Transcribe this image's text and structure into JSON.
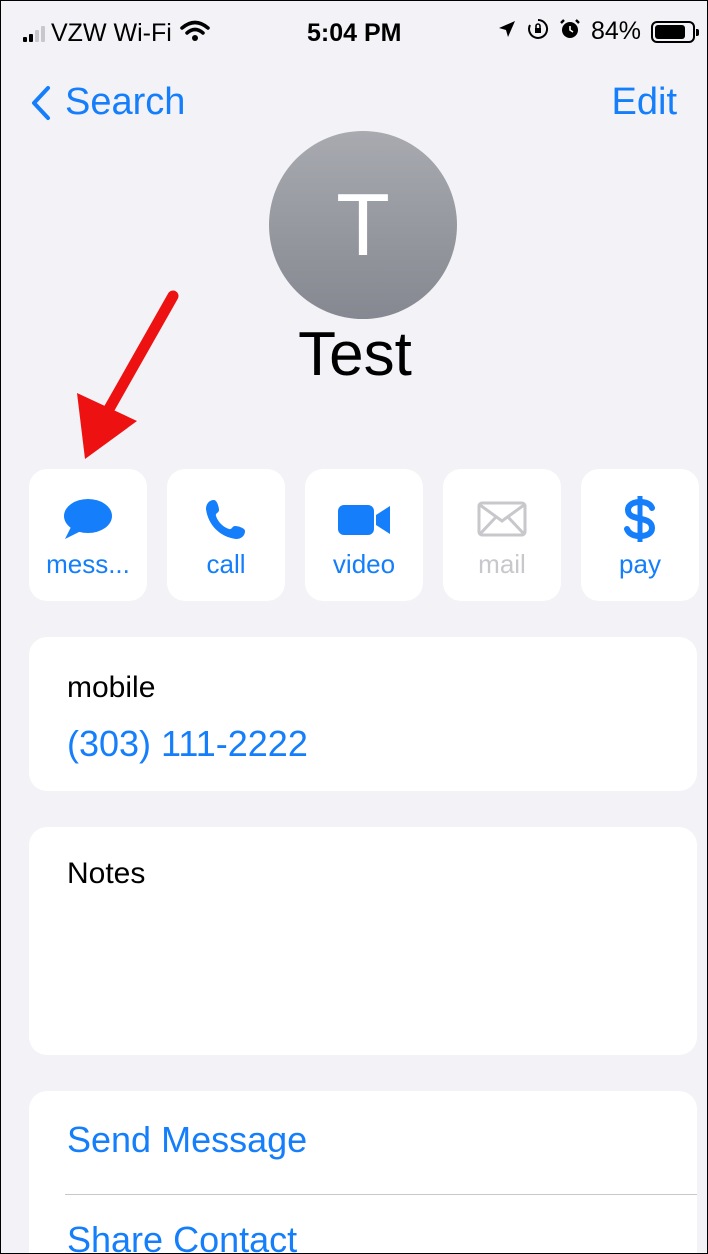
{
  "status_bar": {
    "carrier": "VZW Wi-Fi",
    "time": "5:04 PM",
    "battery_percent": "84%",
    "battery_level": 0.84,
    "icons": [
      "signal-icon",
      "wifi-icon",
      "location-icon",
      "orientation-lock-icon",
      "alarm-icon",
      "battery-icon"
    ]
  },
  "nav": {
    "back_label": "Search",
    "edit_label": "Edit"
  },
  "contact": {
    "initial": "T",
    "name": "Test"
  },
  "actions": [
    {
      "label": "mess...",
      "icon": "message-bubble-icon",
      "enabled": true
    },
    {
      "label": "call",
      "icon": "phone-icon",
      "enabled": true
    },
    {
      "label": "video",
      "icon": "video-camera-icon",
      "enabled": true
    },
    {
      "label": "mail",
      "icon": "mail-icon",
      "enabled": false
    },
    {
      "label": "pay",
      "icon": "dollar-icon",
      "enabled": true
    }
  ],
  "phone": {
    "label": "mobile",
    "number": "(303) 111-2222"
  },
  "notes": {
    "label": "Notes"
  },
  "links": {
    "send_message": "Send Message",
    "share_contact": "Share Contact"
  },
  "colors": {
    "accent": "#147efb",
    "background": "#f2f2f7",
    "annotation_arrow": "#ee1111",
    "disabled": "#c7c7cc"
  }
}
